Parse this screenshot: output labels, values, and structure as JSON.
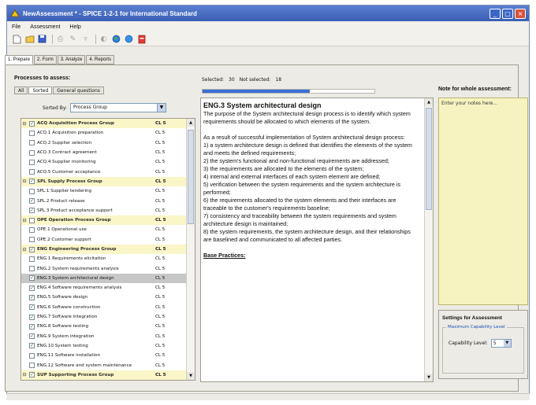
{
  "window": {
    "title": "NewAssessment * - SPICE 1-2-1 for International Standard"
  },
  "menu": [
    "File",
    "Assessment",
    "Help"
  ],
  "toolbar_icons": [
    "new-icon",
    "open-icon",
    "save-icon",
    "print-icon",
    "edit-icon",
    "filter-icon",
    "info-icon",
    "globe-icon",
    "web-icon",
    "pdf-icon"
  ],
  "tabs": [
    "1. Prepare",
    "2. Form",
    "3. Analyze",
    "4. Reports"
  ],
  "left": {
    "label": "Processes to assess:",
    "subtabs": [
      "All",
      "Sorted",
      "General questions"
    ],
    "sort_label": "Sorted By:",
    "sort_value": "Process Group",
    "processes": [
      {
        "type": "group",
        "name": "ACQ Acquisition Process Group",
        "cl": "CL 5",
        "checked": true
      },
      {
        "type": "item",
        "name": "ACQ.1 Acquisition preparation",
        "cl": "CL 5",
        "checked": false
      },
      {
        "type": "item",
        "name": "ACQ.2 Supplier selection",
        "cl": "CL 5",
        "checked": false
      },
      {
        "type": "item",
        "name": "ACQ.3 Contract agreement",
        "cl": "CL 5",
        "checked": false
      },
      {
        "type": "item",
        "name": "ACQ.4 Supplier monitoring",
        "cl": "CL 5",
        "checked": false
      },
      {
        "type": "item",
        "name": "ACQ.5 Customer acceptance",
        "cl": "CL 5",
        "checked": false
      },
      {
        "type": "group",
        "name": "SPL Supply Process Group",
        "cl": "CL 5",
        "checked": true
      },
      {
        "type": "item",
        "name": "SPL.1 Supplier tendering",
        "cl": "CL 5",
        "checked": false
      },
      {
        "type": "item",
        "name": "SPL.2 Product release",
        "cl": "CL 5",
        "checked": true
      },
      {
        "type": "item",
        "name": "SPL.3 Product acceptance support",
        "cl": "CL 5",
        "checked": true
      },
      {
        "type": "group",
        "name": "OPE Operation Process Group",
        "cl": "CL 5",
        "checked": false
      },
      {
        "type": "item",
        "name": "OPE.1 Operational use",
        "cl": "CL 5",
        "checked": false
      },
      {
        "type": "item",
        "name": "OPE.2 Customer support",
        "cl": "CL 5",
        "checked": false
      },
      {
        "type": "group",
        "name": "ENG Engineering Process Group",
        "cl": "CL 5",
        "checked": true
      },
      {
        "type": "item",
        "name": "ENG.1 Requirements elicitation",
        "cl": "CL 5",
        "checked": false
      },
      {
        "type": "item",
        "name": "ENG.2 System requirements analysis",
        "cl": "CL 5",
        "checked": false
      },
      {
        "type": "selected",
        "name": "ENG.3 System architectural design",
        "cl": "CL 5",
        "checked": true
      },
      {
        "type": "item",
        "name": "ENG.4 Software requirements analysis",
        "cl": "CL 5",
        "checked": true
      },
      {
        "type": "item",
        "name": "ENG.5 Software design",
        "cl": "CL 5",
        "checked": true
      },
      {
        "type": "item",
        "name": "ENG.6 Software construction",
        "cl": "CL 5",
        "checked": true
      },
      {
        "type": "item",
        "name": "ENG.7 Software integration",
        "cl": "CL 5",
        "checked": true
      },
      {
        "type": "item",
        "name": "ENG.8 Software testing",
        "cl": "CL 5",
        "checked": true
      },
      {
        "type": "item",
        "name": "ENG.9 System integration",
        "cl": "CL 5",
        "checked": true
      },
      {
        "type": "item",
        "name": "ENG.10 System testing",
        "cl": "CL 5",
        "checked": true
      },
      {
        "type": "item",
        "name": "ENG.11 Software installation",
        "cl": "CL 5",
        "checked": false
      },
      {
        "type": "item",
        "name": "ENG.12 Software and system maintenance",
        "cl": "CL 5",
        "checked": false
      },
      {
        "type": "group",
        "name": "SUP Supporting Process Group",
        "cl": "CL 5",
        "checked": true
      }
    ]
  },
  "middle": {
    "selected_label": "Selected:",
    "selected_count": "30",
    "not_selected_label": "Not selected:",
    "not_selected_count": "18",
    "progress_fraction": 0.625,
    "desc_title": "ENG.3 System architectural design",
    "desc_paragraphs": [
      "The purpose of the System architectural design process is to identify which system requirements should be allocated to which elements of the system.",
      "As a result of successful implementation of System architectural design process:\n1) a system architecture design is defined that identifies the elements of the system and meets the defined requirements;\n2) the system's functional and non-functional requirements are addressed;\n3) the requirements are allocated to the elements of the system;\n4) internal and external interfaces of each system element are defined;\n5) verification between the system requirements and the system architecture is performed;\n6) the requirements allocated to the system elements and their interfaces are traceable to the customer's requirements baseline;\n7) consistency and traceability between the system requirements and system architecture design is maintained;\n8) the system requirements, the system architecture design, and their relationships are baselined and communicated to all affected parties."
    ],
    "base_practices": "Base Practices:"
  },
  "right": {
    "notes_label": "Note for whole assessment:",
    "notes_placeholder": "Enter your notes here...",
    "settings_label": "Settings for Assessment",
    "capability_legend": "Maximum Capability Level",
    "capability_label": "Capability Level:",
    "capability_value": "5"
  }
}
